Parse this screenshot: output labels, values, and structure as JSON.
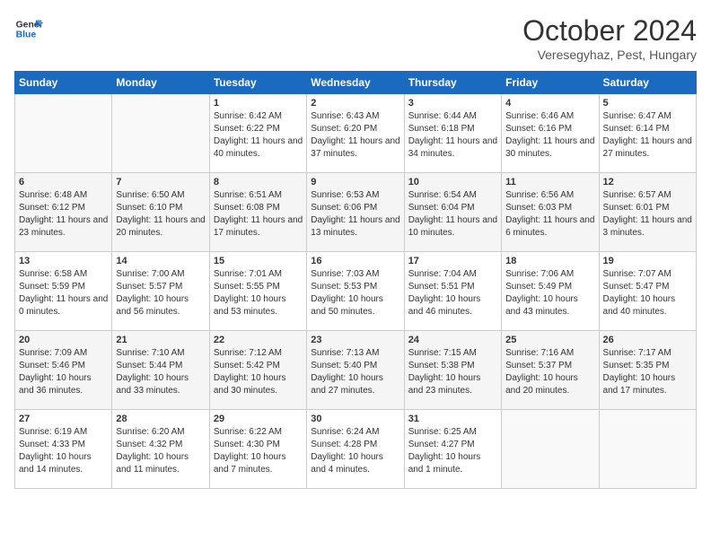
{
  "header": {
    "logo_line1": "General",
    "logo_line2": "Blue",
    "month": "October 2024",
    "location": "Veresegyhaz, Pest, Hungary"
  },
  "days_of_week": [
    "Sunday",
    "Monday",
    "Tuesday",
    "Wednesday",
    "Thursday",
    "Friday",
    "Saturday"
  ],
  "weeks": [
    [
      {
        "day": null,
        "content": ""
      },
      {
        "day": null,
        "content": ""
      },
      {
        "day": "1",
        "content": "Sunrise: 6:42 AM\nSunset: 6:22 PM\nDaylight: 11 hours and 40 minutes."
      },
      {
        "day": "2",
        "content": "Sunrise: 6:43 AM\nSunset: 6:20 PM\nDaylight: 11 hours and 37 minutes."
      },
      {
        "day": "3",
        "content": "Sunrise: 6:44 AM\nSunset: 6:18 PM\nDaylight: 11 hours and 34 minutes."
      },
      {
        "day": "4",
        "content": "Sunrise: 6:46 AM\nSunset: 6:16 PM\nDaylight: 11 hours and 30 minutes."
      },
      {
        "day": "5",
        "content": "Sunrise: 6:47 AM\nSunset: 6:14 PM\nDaylight: 11 hours and 27 minutes."
      }
    ],
    [
      {
        "day": "6",
        "content": "Sunrise: 6:48 AM\nSunset: 6:12 PM\nDaylight: 11 hours and 23 minutes."
      },
      {
        "day": "7",
        "content": "Sunrise: 6:50 AM\nSunset: 6:10 PM\nDaylight: 11 hours and 20 minutes."
      },
      {
        "day": "8",
        "content": "Sunrise: 6:51 AM\nSunset: 6:08 PM\nDaylight: 11 hours and 17 minutes."
      },
      {
        "day": "9",
        "content": "Sunrise: 6:53 AM\nSunset: 6:06 PM\nDaylight: 11 hours and 13 minutes."
      },
      {
        "day": "10",
        "content": "Sunrise: 6:54 AM\nSunset: 6:04 PM\nDaylight: 11 hours and 10 minutes."
      },
      {
        "day": "11",
        "content": "Sunrise: 6:56 AM\nSunset: 6:03 PM\nDaylight: 11 hours and 6 minutes."
      },
      {
        "day": "12",
        "content": "Sunrise: 6:57 AM\nSunset: 6:01 PM\nDaylight: 11 hours and 3 minutes."
      }
    ],
    [
      {
        "day": "13",
        "content": "Sunrise: 6:58 AM\nSunset: 5:59 PM\nDaylight: 11 hours and 0 minutes."
      },
      {
        "day": "14",
        "content": "Sunrise: 7:00 AM\nSunset: 5:57 PM\nDaylight: 10 hours and 56 minutes."
      },
      {
        "day": "15",
        "content": "Sunrise: 7:01 AM\nSunset: 5:55 PM\nDaylight: 10 hours and 53 minutes."
      },
      {
        "day": "16",
        "content": "Sunrise: 7:03 AM\nSunset: 5:53 PM\nDaylight: 10 hours and 50 minutes."
      },
      {
        "day": "17",
        "content": "Sunrise: 7:04 AM\nSunset: 5:51 PM\nDaylight: 10 hours and 46 minutes."
      },
      {
        "day": "18",
        "content": "Sunrise: 7:06 AM\nSunset: 5:49 PM\nDaylight: 10 hours and 43 minutes."
      },
      {
        "day": "19",
        "content": "Sunrise: 7:07 AM\nSunset: 5:47 PM\nDaylight: 10 hours and 40 minutes."
      }
    ],
    [
      {
        "day": "20",
        "content": "Sunrise: 7:09 AM\nSunset: 5:46 PM\nDaylight: 10 hours and 36 minutes."
      },
      {
        "day": "21",
        "content": "Sunrise: 7:10 AM\nSunset: 5:44 PM\nDaylight: 10 hours and 33 minutes."
      },
      {
        "day": "22",
        "content": "Sunrise: 7:12 AM\nSunset: 5:42 PM\nDaylight: 10 hours and 30 minutes."
      },
      {
        "day": "23",
        "content": "Sunrise: 7:13 AM\nSunset: 5:40 PM\nDaylight: 10 hours and 27 minutes."
      },
      {
        "day": "24",
        "content": "Sunrise: 7:15 AM\nSunset: 5:38 PM\nDaylight: 10 hours and 23 minutes."
      },
      {
        "day": "25",
        "content": "Sunrise: 7:16 AM\nSunset: 5:37 PM\nDaylight: 10 hours and 20 minutes."
      },
      {
        "day": "26",
        "content": "Sunrise: 7:17 AM\nSunset: 5:35 PM\nDaylight: 10 hours and 17 minutes."
      }
    ],
    [
      {
        "day": "27",
        "content": "Sunrise: 6:19 AM\nSunset: 4:33 PM\nDaylight: 10 hours and 14 minutes."
      },
      {
        "day": "28",
        "content": "Sunrise: 6:20 AM\nSunset: 4:32 PM\nDaylight: 10 hours and 11 minutes."
      },
      {
        "day": "29",
        "content": "Sunrise: 6:22 AM\nSunset: 4:30 PM\nDaylight: 10 hours and 7 minutes."
      },
      {
        "day": "30",
        "content": "Sunrise: 6:24 AM\nSunset: 4:28 PM\nDaylight: 10 hours and 4 minutes."
      },
      {
        "day": "31",
        "content": "Sunrise: 6:25 AM\nSunset: 4:27 PM\nDaylight: 10 hours and 1 minute."
      },
      {
        "day": null,
        "content": ""
      },
      {
        "day": null,
        "content": ""
      }
    ]
  ]
}
